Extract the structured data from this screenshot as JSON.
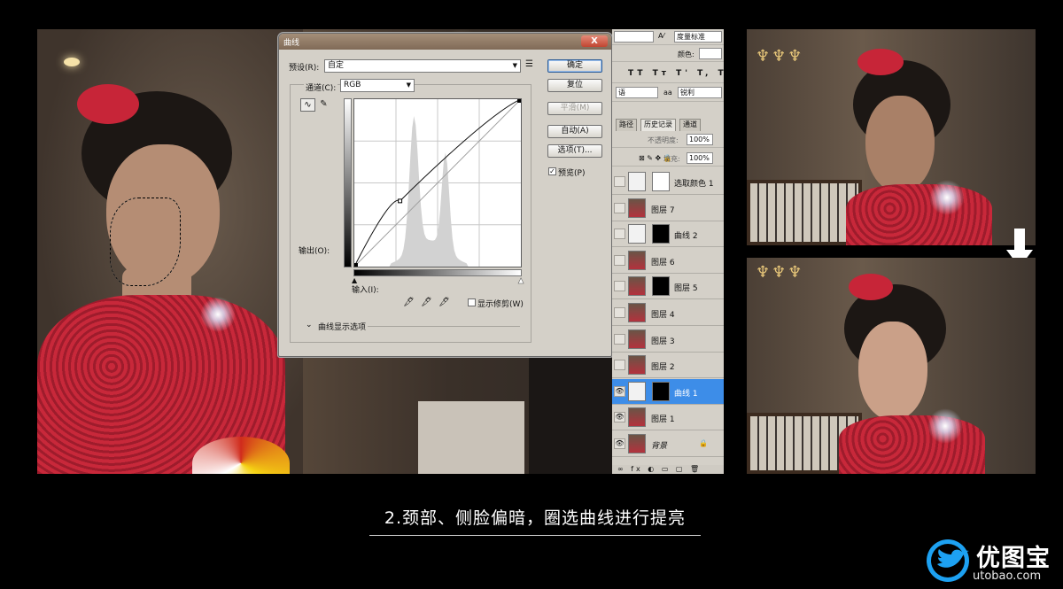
{
  "curves_dialog": {
    "title": "曲线",
    "close_label": "X",
    "preset_label": "预设(R):",
    "preset_value": "自定",
    "channel_label": "通道(C):",
    "channel_value": "RGB",
    "output_label": "输出(O):",
    "input_label": "输入(I):",
    "show_clipping_label": "显示修剪(W)",
    "curve_display_options_label": "曲线显示选项",
    "buttons": {
      "ok": "确定",
      "reset": "复位",
      "smooth": "平滑(M)",
      "auto": "自动(A)",
      "options": "选项(T)..."
    },
    "preview_label": "预览(P)",
    "preview_checked": true,
    "curve_point": {
      "input": 70,
      "output": 100
    },
    "icons": [
      "curve-tool-icon",
      "pencil-icon",
      "preset-menu-icon",
      "black-eyedropper-icon",
      "gray-eyedropper-icon",
      "white-eyedropper-icon"
    ]
  },
  "options_bar": {
    "measure_scale": "度量标准",
    "color_label": "颜色:",
    "type_buttons": [
      "TT",
      "Tт",
      "T'",
      "T,",
      "T",
      "Ŧ"
    ],
    "language_value": "语",
    "aa_label": "aa",
    "aa_value": "锐利"
  },
  "layers_panel": {
    "tabs": [
      "路径",
      "历史记录",
      "通道"
    ],
    "opacity_label": "不透明度:",
    "opacity_value": "100%",
    "fill_label": "填充:",
    "fill_value": "100%",
    "layers": [
      {
        "name": "选取颜色 1",
        "visible": false,
        "has_mask": true
      },
      {
        "name": "图层 7",
        "visible": false,
        "has_mask": false
      },
      {
        "name": "曲线 2",
        "visible": false,
        "has_mask": true
      },
      {
        "name": "图层 6",
        "visible": false,
        "has_mask": false
      },
      {
        "name": "图层 5",
        "visible": false,
        "has_mask": true
      },
      {
        "name": "图层 4",
        "visible": false,
        "has_mask": false
      },
      {
        "name": "图层 3",
        "visible": false,
        "has_mask": false
      },
      {
        "name": "图层 2",
        "visible": false,
        "has_mask": false
      },
      {
        "name": "曲线 1",
        "visible": true,
        "has_mask": true,
        "selected": true
      },
      {
        "name": "图层 1",
        "visible": true,
        "has_mask": false
      },
      {
        "name": "背景",
        "visible": true,
        "has_mask": false,
        "locked": true
      }
    ]
  },
  "caption": "2.颈部、侧脸偏暗，圈选曲线进行提亮",
  "logo": {
    "name": "优图宝",
    "url": "utobao.com"
  },
  "colors": {
    "selected_layer": "#3d8de8",
    "dialog_bg": "#d4d0c8",
    "logo_blue": "#1da1f2"
  }
}
